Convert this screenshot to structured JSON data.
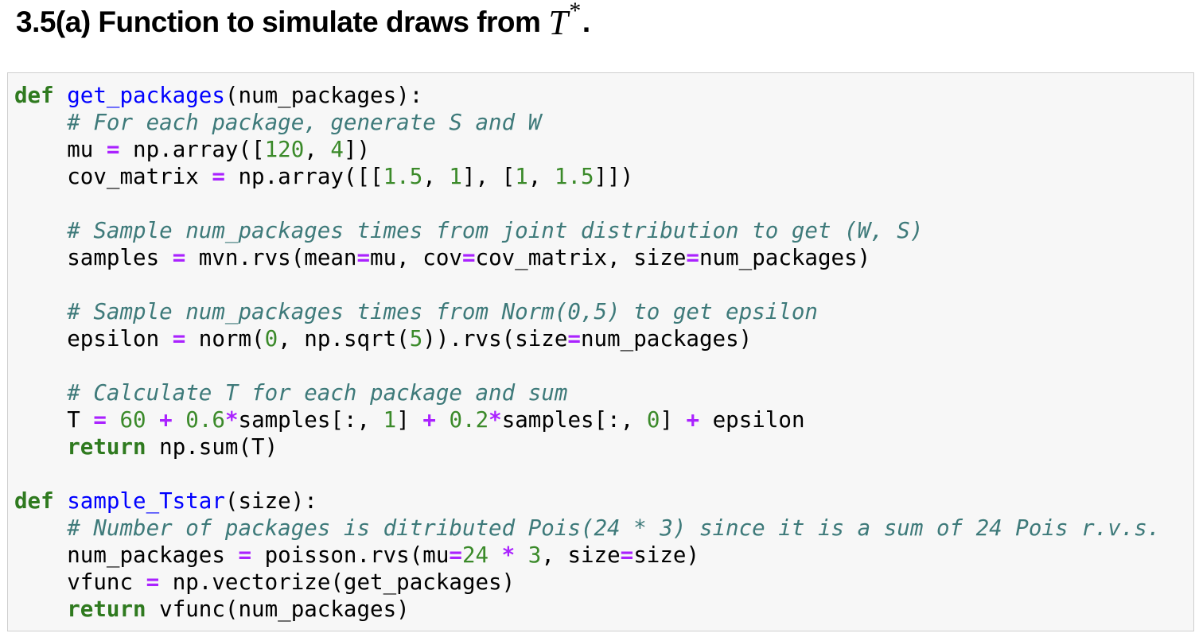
{
  "heading": {
    "prefix": "3.5(a) Function to simulate draws from",
    "math_symbol": "T",
    "superscript": "*",
    "suffix": "."
  },
  "code_cell": {
    "lines": [
      [
        {
          "t": "kw",
          "s": "def"
        },
        {
          "t": "",
          "s": " "
        },
        {
          "t": "fn",
          "s": "get_packages"
        },
        {
          "t": "",
          "s": "(num_packages):"
        }
      ],
      [
        {
          "t": "",
          "s": "    "
        },
        {
          "t": "cm",
          "s": "# For each package, generate S and W"
        }
      ],
      [
        {
          "t": "",
          "s": "    mu "
        },
        {
          "t": "op",
          "s": "="
        },
        {
          "t": "",
          "s": " np.array(["
        },
        {
          "t": "num",
          "s": "120"
        },
        {
          "t": "",
          "s": ", "
        },
        {
          "t": "num",
          "s": "4"
        },
        {
          "t": "",
          "s": "])"
        }
      ],
      [
        {
          "t": "",
          "s": "    cov_matrix "
        },
        {
          "t": "op",
          "s": "="
        },
        {
          "t": "",
          "s": " np.array([["
        },
        {
          "t": "num",
          "s": "1.5"
        },
        {
          "t": "",
          "s": ", "
        },
        {
          "t": "num",
          "s": "1"
        },
        {
          "t": "",
          "s": "], ["
        },
        {
          "t": "num",
          "s": "1"
        },
        {
          "t": "",
          "s": ", "
        },
        {
          "t": "num",
          "s": "1.5"
        },
        {
          "t": "",
          "s": "]])"
        }
      ],
      [],
      [
        {
          "t": "",
          "s": "    "
        },
        {
          "t": "cm",
          "s": "# Sample num_packages times from joint distribution to get (W, S)"
        }
      ],
      [
        {
          "t": "",
          "s": "    samples "
        },
        {
          "t": "op",
          "s": "="
        },
        {
          "t": "",
          "s": " mvn.rvs(mean"
        },
        {
          "t": "op",
          "s": "="
        },
        {
          "t": "",
          "s": "mu, cov"
        },
        {
          "t": "op",
          "s": "="
        },
        {
          "t": "",
          "s": "cov_matrix, size"
        },
        {
          "t": "op",
          "s": "="
        },
        {
          "t": "",
          "s": "num_packages)"
        }
      ],
      [],
      [
        {
          "t": "",
          "s": "    "
        },
        {
          "t": "cm",
          "s": "# Sample num_packages times from Norm(0,5) to get epsilon"
        }
      ],
      [
        {
          "t": "",
          "s": "    epsilon "
        },
        {
          "t": "op",
          "s": "="
        },
        {
          "t": "",
          "s": " norm("
        },
        {
          "t": "num",
          "s": "0"
        },
        {
          "t": "",
          "s": ", np.sqrt("
        },
        {
          "t": "num",
          "s": "5"
        },
        {
          "t": "",
          "s": ")).rvs(size"
        },
        {
          "t": "op",
          "s": "="
        },
        {
          "t": "",
          "s": "num_packages)"
        }
      ],
      [],
      [
        {
          "t": "",
          "s": "    "
        },
        {
          "t": "cm",
          "s": "# Calculate T for each package and sum"
        }
      ],
      [
        {
          "t": "",
          "s": "    T "
        },
        {
          "t": "op",
          "s": "="
        },
        {
          "t": "",
          "s": " "
        },
        {
          "t": "num",
          "s": "60"
        },
        {
          "t": "",
          "s": " "
        },
        {
          "t": "op",
          "s": "+"
        },
        {
          "t": "",
          "s": " "
        },
        {
          "t": "num",
          "s": "0.6"
        },
        {
          "t": "op",
          "s": "*"
        },
        {
          "t": "",
          "s": "samples[:, "
        },
        {
          "t": "num",
          "s": "1"
        },
        {
          "t": "",
          "s": "] "
        },
        {
          "t": "op",
          "s": "+"
        },
        {
          "t": "",
          "s": " "
        },
        {
          "t": "num",
          "s": "0.2"
        },
        {
          "t": "op",
          "s": "*"
        },
        {
          "t": "",
          "s": "samples[:, "
        },
        {
          "t": "num",
          "s": "0"
        },
        {
          "t": "",
          "s": "] "
        },
        {
          "t": "op",
          "s": "+"
        },
        {
          "t": "",
          "s": " epsilon"
        }
      ],
      [
        {
          "t": "",
          "s": "    "
        },
        {
          "t": "kw",
          "s": "return"
        },
        {
          "t": "",
          "s": " np.sum(T)"
        }
      ],
      [],
      [
        {
          "t": "kw",
          "s": "def"
        },
        {
          "t": "",
          "s": " "
        },
        {
          "t": "fn",
          "s": "sample_Tstar"
        },
        {
          "t": "",
          "s": "(size):"
        }
      ],
      [
        {
          "t": "",
          "s": "    "
        },
        {
          "t": "cm",
          "s": "# Number of packages is ditributed Pois(24 * 3) since it is a sum of 24 Pois r.v.s."
        }
      ],
      [
        {
          "t": "",
          "s": "    num_packages "
        },
        {
          "t": "op",
          "s": "="
        },
        {
          "t": "",
          "s": " poisson.rvs(mu"
        },
        {
          "t": "op",
          "s": "="
        },
        {
          "t": "num",
          "s": "24"
        },
        {
          "t": "",
          "s": " "
        },
        {
          "t": "op",
          "s": "*"
        },
        {
          "t": "",
          "s": " "
        },
        {
          "t": "num",
          "s": "3"
        },
        {
          "t": "",
          "s": ", size"
        },
        {
          "t": "op",
          "s": "="
        },
        {
          "t": "",
          "s": "size)"
        }
      ],
      [
        {
          "t": "",
          "s": "    vfunc "
        },
        {
          "t": "op",
          "s": "="
        },
        {
          "t": "",
          "s": " np.vectorize(get_packages)"
        }
      ],
      [
        {
          "t": "",
          "s": "    "
        },
        {
          "t": "kw",
          "s": "return"
        },
        {
          "t": "",
          "s": " vfunc(num_packages)"
        }
      ]
    ]
  }
}
